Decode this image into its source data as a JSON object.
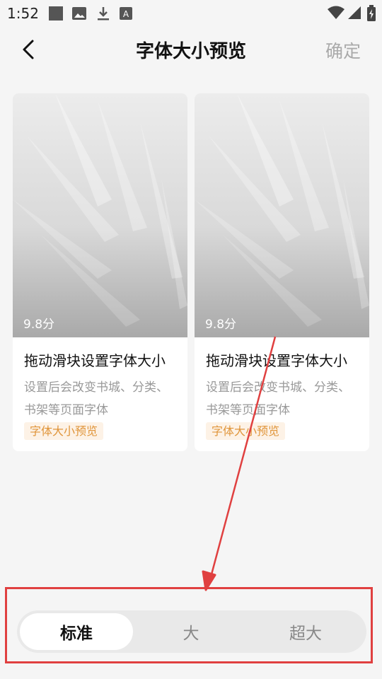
{
  "status_bar": {
    "time": "1:52",
    "icons": [
      "square-icon",
      "image-icon",
      "download-icon",
      "font-a-icon"
    ],
    "right_icons": [
      "wifi-icon",
      "signal-icon",
      "battery-icon"
    ]
  },
  "header": {
    "back_icon": "chevron-left-icon",
    "title": "字体大小预览",
    "confirm_label": "确定"
  },
  "cards": [
    {
      "score": "9.8分",
      "title": "拖动滑块设置字体大小",
      "description": "设置后会改变书城、分类、书架等页面字体",
      "tag": "字体大小预览"
    },
    {
      "score": "9.8分",
      "title": "拖动滑块设置字体大小",
      "description": "设置后会改变书城、分类、书架等页面字体",
      "tag": "字体大小预览"
    }
  ],
  "size_selector": {
    "options": [
      "标准",
      "大",
      "超大"
    ],
    "selected": "标准"
  },
  "colors": {
    "annotation": "#e04040",
    "tag_text": "#e0953a",
    "tag_bg": "#fdf2e6",
    "confirm_disabled": "#aaaaaa"
  }
}
